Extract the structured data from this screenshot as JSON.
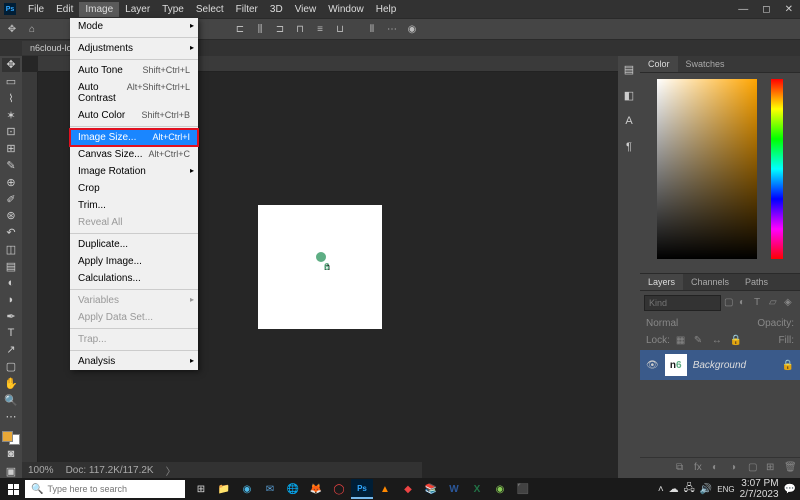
{
  "app": {
    "logo": "Ps"
  },
  "menubar": [
    "File",
    "Edit",
    "Image",
    "Layer",
    "Type",
    "Select",
    "Filter",
    "3D",
    "View",
    "Window",
    "Help"
  ],
  "activeMenu": "Image",
  "dropdown": [
    {
      "label": "Mode",
      "sub": true
    },
    {
      "sep": true
    },
    {
      "label": "Adjustments",
      "sub": true
    },
    {
      "sep": true
    },
    {
      "label": "Auto Tone",
      "shortcut": "Shift+Ctrl+L"
    },
    {
      "label": "Auto Contrast",
      "shortcut": "Alt+Shift+Ctrl+L"
    },
    {
      "label": "Auto Color",
      "shortcut": "Shift+Ctrl+B"
    },
    {
      "sep": true
    },
    {
      "label": "Image Size...",
      "shortcut": "Alt+Ctrl+I",
      "highlight": true
    },
    {
      "label": "Canvas Size...",
      "shortcut": "Alt+Ctrl+C"
    },
    {
      "label": "Image Rotation",
      "sub": true
    },
    {
      "label": "Crop"
    },
    {
      "label": "Trim..."
    },
    {
      "label": "Reveal All",
      "disabled": true
    },
    {
      "sep": true
    },
    {
      "label": "Duplicate..."
    },
    {
      "label": "Apply Image..."
    },
    {
      "label": "Calculations..."
    },
    {
      "sep": true
    },
    {
      "label": "Variables",
      "sub": true,
      "disabled": true
    },
    {
      "label": "Apply Data Set...",
      "disabled": true
    },
    {
      "sep": true
    },
    {
      "label": "Trap...",
      "disabled": true
    },
    {
      "sep": true
    },
    {
      "label": "Analysis",
      "sub": true
    }
  ],
  "documentTab": "n6cloud-lo",
  "colorTabs": [
    "Color",
    "Swatches"
  ],
  "layerTabs": [
    "Layers",
    "Channels",
    "Paths"
  ],
  "layerSearch": {
    "placeholder": "Kind"
  },
  "layerOpts": {
    "mode": "Normal",
    "opacity": "Opacity:"
  },
  "layerOpts2": {
    "lock": "Lock:",
    "fill": "Fill:"
  },
  "layer": {
    "name": "Background"
  },
  "status": {
    "zoom": "100%",
    "docinfo": "Doc: 117.2K/117.2K"
  },
  "taskbar": {
    "searchPlaceholder": "Type here to search",
    "time": "3:07 PM",
    "date": "2/7/2023"
  }
}
